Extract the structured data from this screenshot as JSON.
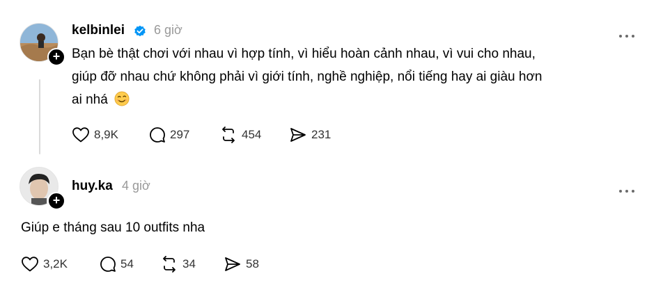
{
  "post1": {
    "username": "kelbinlei",
    "verified": true,
    "time": "6 giờ",
    "content_line1": "Bạn bè thật chơi với nhau vì hợp tính, vì hiểu hoàn cảnh nhau, vì vui cho nhau,",
    "content_line2": "giúp đỡ nhau chứ không phải vì giới tính, nghề nghiệp, nổi tiếng hay ai giàu hơn",
    "content_line3": "ai nhá",
    "emoji": "wink-face-icon",
    "likes": "8,9K",
    "comments": "297",
    "reposts": "454",
    "shares": "231"
  },
  "post2": {
    "username": "huy.ka",
    "time": "4 giờ",
    "content": "Giúp e tháng sau 10 outfits nha",
    "likes": "3,2K",
    "comments": "54",
    "reposts": "34",
    "shares": "58"
  },
  "colors": {
    "verified": "#0095f6",
    "muted": "#999999",
    "thread_line": "#dadada"
  }
}
